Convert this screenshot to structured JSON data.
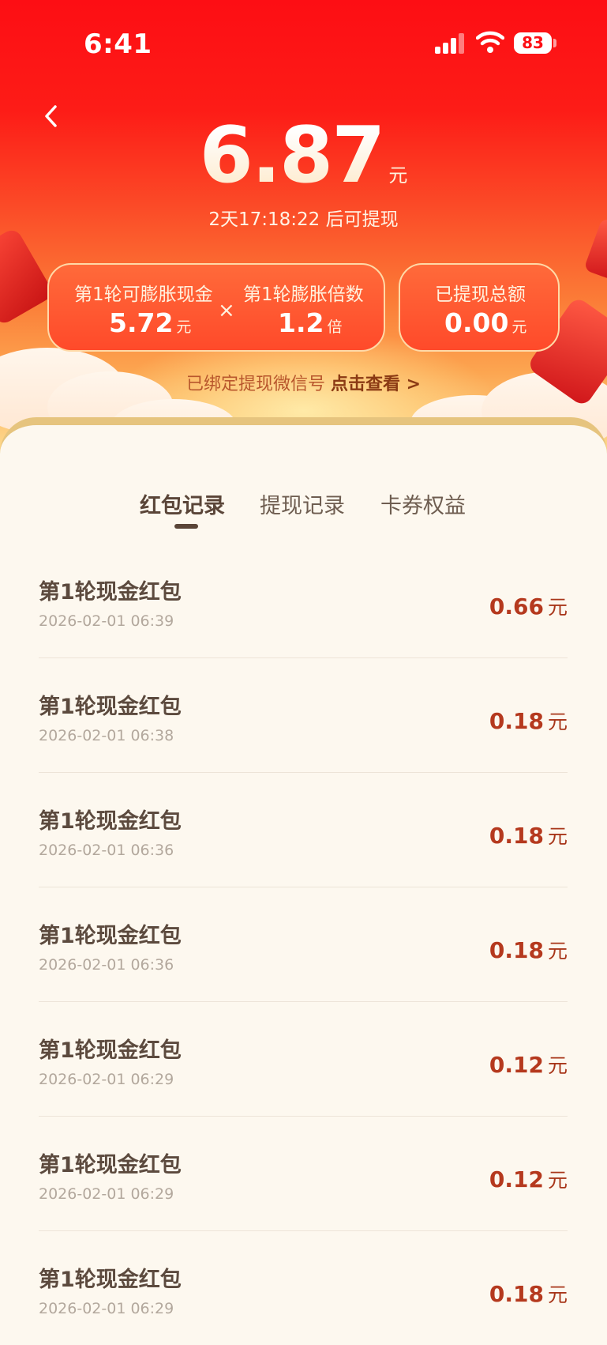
{
  "status_bar": {
    "time": "6:41",
    "battery": "83"
  },
  "header": {
    "amount": "6.87",
    "amount_unit": "元",
    "countdown": "2天17:18:22 后可提现"
  },
  "cards": {
    "inflatable_label": "第1轮可膨胀现金",
    "inflatable_value": "5.72",
    "inflatable_unit": "元",
    "multiplier_label": "第1轮膨胀倍数",
    "multiplier_value": "1.2",
    "multiplier_unit": "倍",
    "times_symbol": "×",
    "withdrawn_label": "已提现总额",
    "withdrawn_value": "0.00",
    "withdrawn_unit": "元"
  },
  "bind_notice": {
    "text": "已绑定提现微信号",
    "link": "点击查看 >"
  },
  "tabs": [
    {
      "label": "红包记录",
      "active": true
    },
    {
      "label": "提现记录",
      "active": false
    },
    {
      "label": "卡券权益",
      "active": false
    }
  ],
  "records": [
    {
      "title": "第1轮现金红包",
      "date": "2026-02-01 06:39",
      "amount": "0.66",
      "unit": "元"
    },
    {
      "title": "第1轮现金红包",
      "date": "2026-02-01 06:38",
      "amount": "0.18",
      "unit": "元"
    },
    {
      "title": "第1轮现金红包",
      "date": "2026-02-01 06:36",
      "amount": "0.18",
      "unit": "元"
    },
    {
      "title": "第1轮现金红包",
      "date": "2026-02-01 06:36",
      "amount": "0.18",
      "unit": "元"
    },
    {
      "title": "第1轮现金红包",
      "date": "2026-02-01 06:29",
      "amount": "0.12",
      "unit": "元"
    },
    {
      "title": "第1轮现金红包",
      "date": "2026-02-01 06:29",
      "amount": "0.12",
      "unit": "元"
    },
    {
      "title": "第1轮现金红包",
      "date": "2026-02-01 06:29",
      "amount": "0.18",
      "unit": "元"
    }
  ]
}
